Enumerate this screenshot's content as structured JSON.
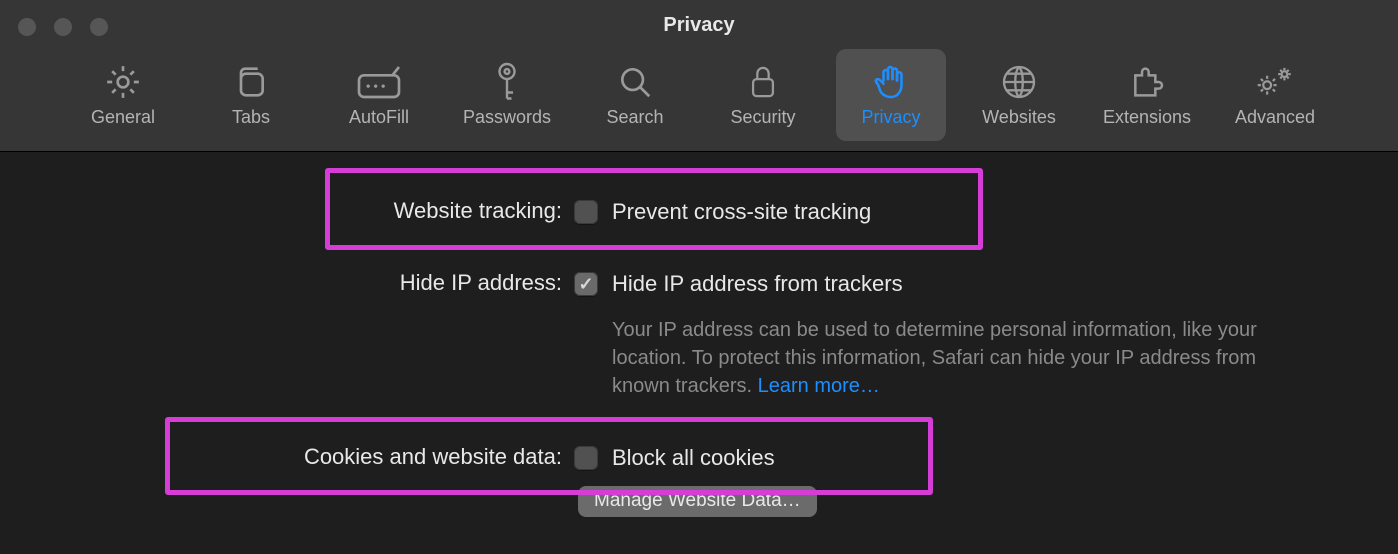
{
  "window": {
    "title": "Privacy"
  },
  "tabs": {
    "general": {
      "label": "General"
    },
    "tabs": {
      "label": "Tabs"
    },
    "autofill": {
      "label": "AutoFill"
    },
    "passwords": {
      "label": "Passwords"
    },
    "search": {
      "label": "Search"
    },
    "security": {
      "label": "Security"
    },
    "privacy": {
      "label": "Privacy"
    },
    "websites": {
      "label": "Websites"
    },
    "extensions": {
      "label": "Extensions"
    },
    "advanced": {
      "label": "Advanced"
    }
  },
  "settings": {
    "tracking": {
      "label": "Website tracking:",
      "opt": "Prevent cross-site tracking",
      "checked": false
    },
    "ip": {
      "label": "Hide IP address:",
      "opt": "Hide IP address from trackers",
      "checked": true,
      "desc": "Your IP address can be used to determine personal information, like your location. To protect this information, Safari can hide your IP address from known trackers. ",
      "learn": "Learn more…"
    },
    "cookies": {
      "label": "Cookies and website data:",
      "opt": "Block all cookies",
      "checked": false,
      "btn": "Manage Website Data…"
    }
  },
  "colors": {
    "accent": "#1e8eff",
    "highlight": "#d63cd6"
  }
}
